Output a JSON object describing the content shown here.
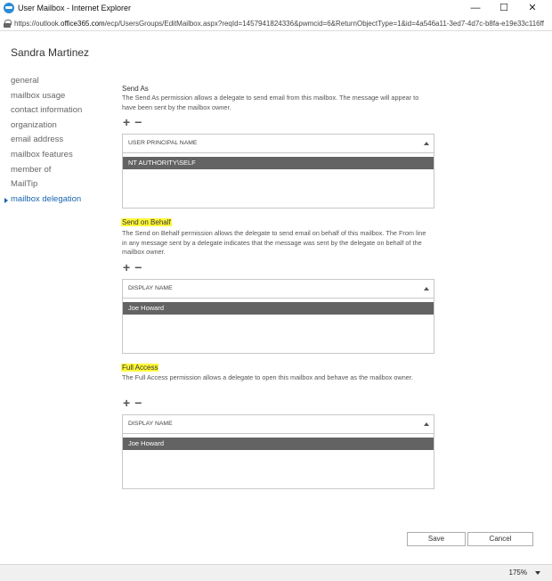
{
  "window": {
    "title": "User Mailbox - Internet Explorer",
    "controls": {
      "minimize": "—",
      "maximize": "☐",
      "close": "✕"
    }
  },
  "address": {
    "prefix": "https://outlook.",
    "domain": "office365.com",
    "path": "/ecp/UsersGroups/EditMailbox.aspx?reqId=1457941824336&pwmcid=6&ReturnObjectType=1&id=4a546a11-3ed7-4d7c-b8fa-e19e33c116ff"
  },
  "page_title": "Sandra Martinez",
  "nav": {
    "items": [
      {
        "label": "general"
      },
      {
        "label": "mailbox usage"
      },
      {
        "label": "contact information"
      },
      {
        "label": "organization"
      },
      {
        "label": "email address"
      },
      {
        "label": "mailbox features"
      },
      {
        "label": "member of"
      },
      {
        "label": "MailTip"
      },
      {
        "label": "mailbox delegation"
      }
    ],
    "active_index": 8
  },
  "send_as": {
    "title": "Send As",
    "description": "The Send As permission allows a delegate to send email from this mailbox. The message will appear to have been sent by the mailbox owner.",
    "column": "USER PRINCIPAL NAME",
    "rows": [
      "NT AUTHORITY\\SELF"
    ]
  },
  "send_on_behalf": {
    "title": "Send on Behalf",
    "highlighted": true,
    "description": "The Send on Behalf permission allows the delegate to send email on behalf of this mailbox. The From line in any message sent by a delegate indicates that the message was sent by the delegate on behalf of the mailbox owner.",
    "column": "DISPLAY NAME",
    "rows": [
      "Joe Howard"
    ]
  },
  "full_access": {
    "title": "Full Access",
    "highlighted": true,
    "description": "The Full Access permission allows a delegate to open this mailbox and behave as the mailbox owner.",
    "column": "DISPLAY NAME",
    "rows": [
      "Joe Howard"
    ]
  },
  "actions": {
    "plus": "+",
    "minus": "−"
  },
  "buttons": {
    "save": "Save",
    "cancel": "Cancel"
  },
  "status": {
    "zoom": "175%"
  },
  "colors": {
    "accent": "#1a64b0",
    "highlight": "#fff83a",
    "selected_row": "#636363"
  }
}
